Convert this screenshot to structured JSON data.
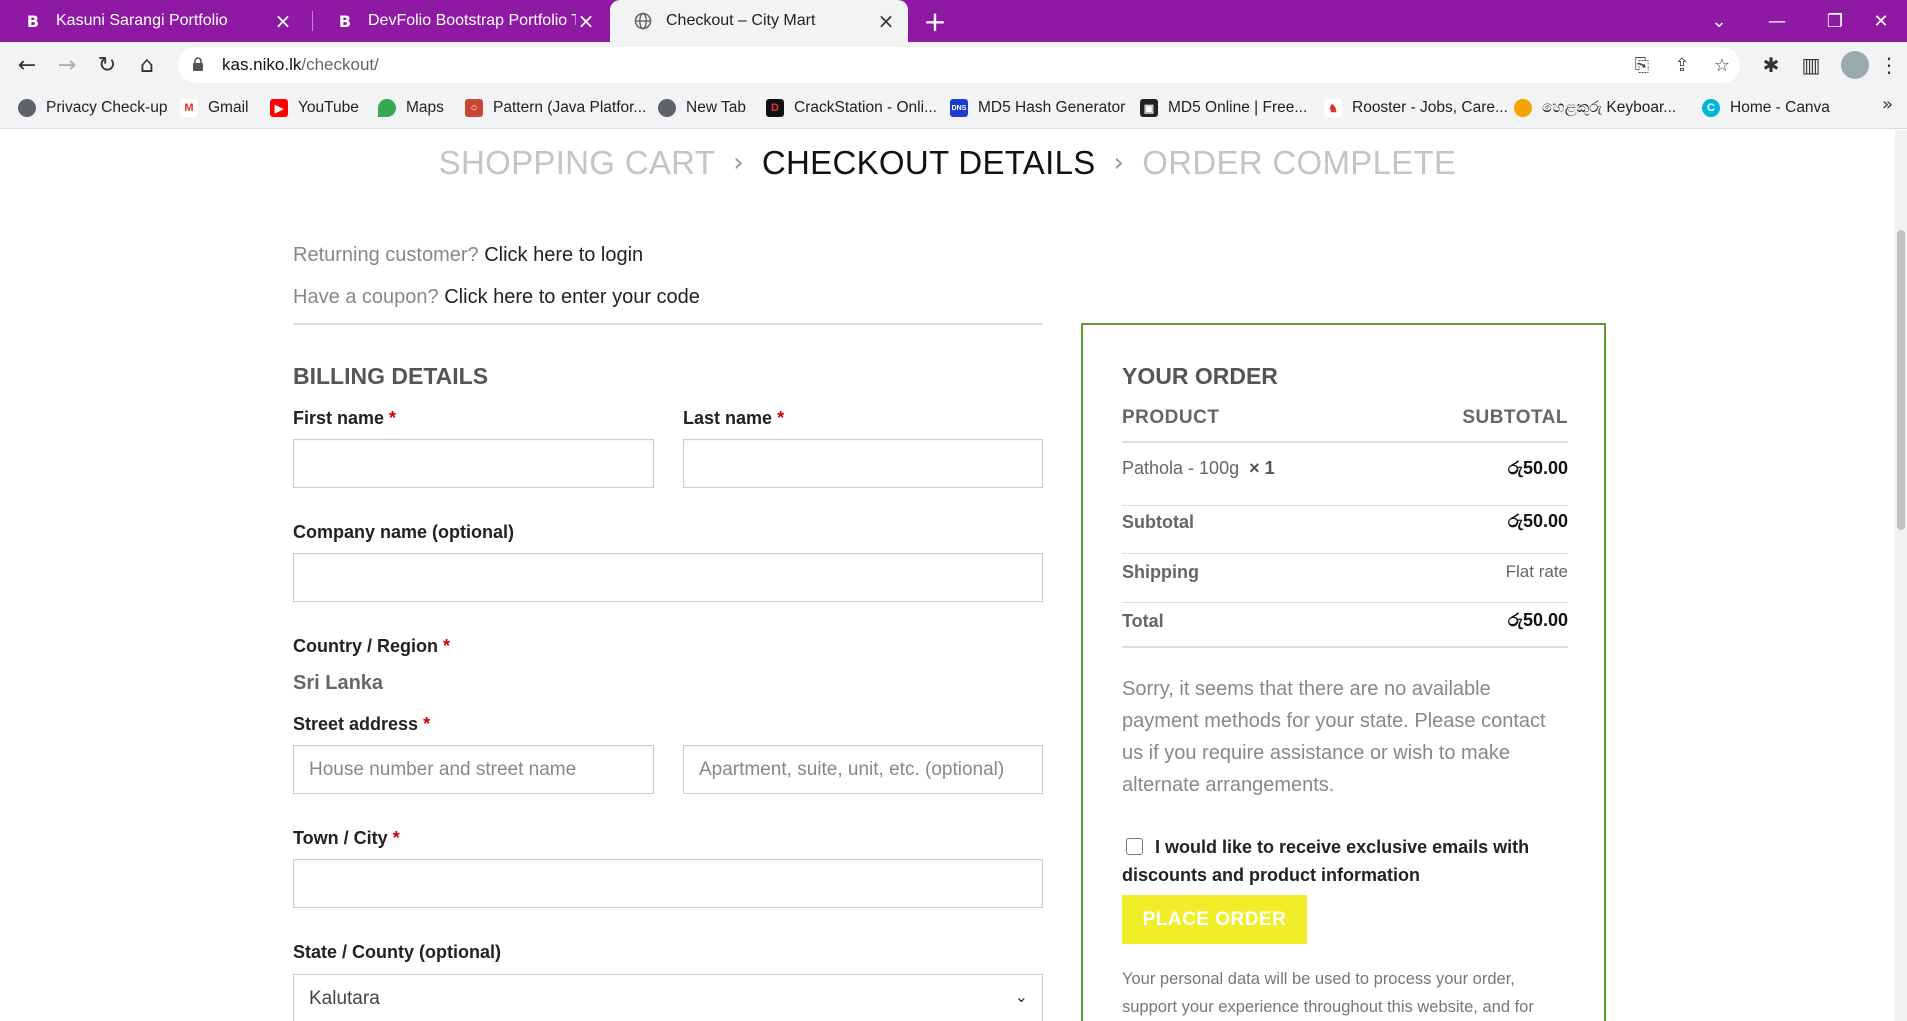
{
  "browser": {
    "tabs": [
      {
        "title": "Kasuni Sarangi Portfolio",
        "favicon": "B"
      },
      {
        "title": "DevFolio Bootstrap Portfolio Tem",
        "favicon": "B"
      },
      {
        "title": "Checkout – City Mart",
        "favicon": "globe-icon"
      }
    ],
    "new_tab": "+",
    "url_host": "kas.niko.lk",
    "url_path": "/checkout/",
    "bookmarks": [
      "Privacy Check-up",
      "Gmail",
      "YouTube",
      "Maps",
      "Pattern (Java Platfor...",
      "New Tab",
      "CrackStation - Onli...",
      "MD5 Hash Generator",
      "MD5 Online | Free...",
      "Rooster - Jobs, Care...",
      "හෙළකුරු Keyboar...",
      "Home - Canva"
    ],
    "colors": {
      "tabbar": "#8e1aa4"
    }
  },
  "steps": {
    "cart": "SHOPPING CART",
    "checkout": "CHECKOUT DETAILS",
    "complete": "ORDER COMPLETE",
    "sep": "›"
  },
  "notices": {
    "returning_prefix": "Returning customer?",
    "returning_link": "Click here to login",
    "coupon_prefix": "Have a coupon?",
    "coupon_link": "Click here to enter your code"
  },
  "billing": {
    "heading": "BILLING DETAILS",
    "required_mark": "*",
    "first_name_label": "First name",
    "last_name_label": "Last name",
    "company_label": "Company name (optional)",
    "country_label": "Country / Region",
    "country_value": "Sri Lanka",
    "street_label": "Street address",
    "street1_placeholder": "House number and street name",
    "street2_placeholder": "Apartment, suite, unit, etc. (optional)",
    "city_label": "Town / City",
    "state_label": "State / County (optional)",
    "state_value": "Kalutara"
  },
  "order": {
    "heading": "YOUR ORDER",
    "col_product": "PRODUCT",
    "col_subtotal": "SUBTOTAL",
    "item_name": "Pathola - 100g",
    "item_qty": "× 1",
    "item_price": "රු50.00",
    "subtotal_label": "Subtotal",
    "subtotal_value": "රු50.00",
    "shipping_label": "Shipping",
    "shipping_value": "Flat rate",
    "total_label": "Total",
    "total_value": "රු50.00",
    "payment_message": "Sorry, it seems that there are no available payment methods for your state. Please contact us if you require assistance or wish to make alternate arrangements.",
    "newsletter_label": "I would like to receive exclusive emails with discounts and product information",
    "place_order": "PLACE ORDER",
    "privacy_text": "Your personal data will be used to process your order, support your experience throughout this website, and for",
    "colors": {
      "border": "#5aa02c",
      "button": "#f0ee29"
    }
  }
}
